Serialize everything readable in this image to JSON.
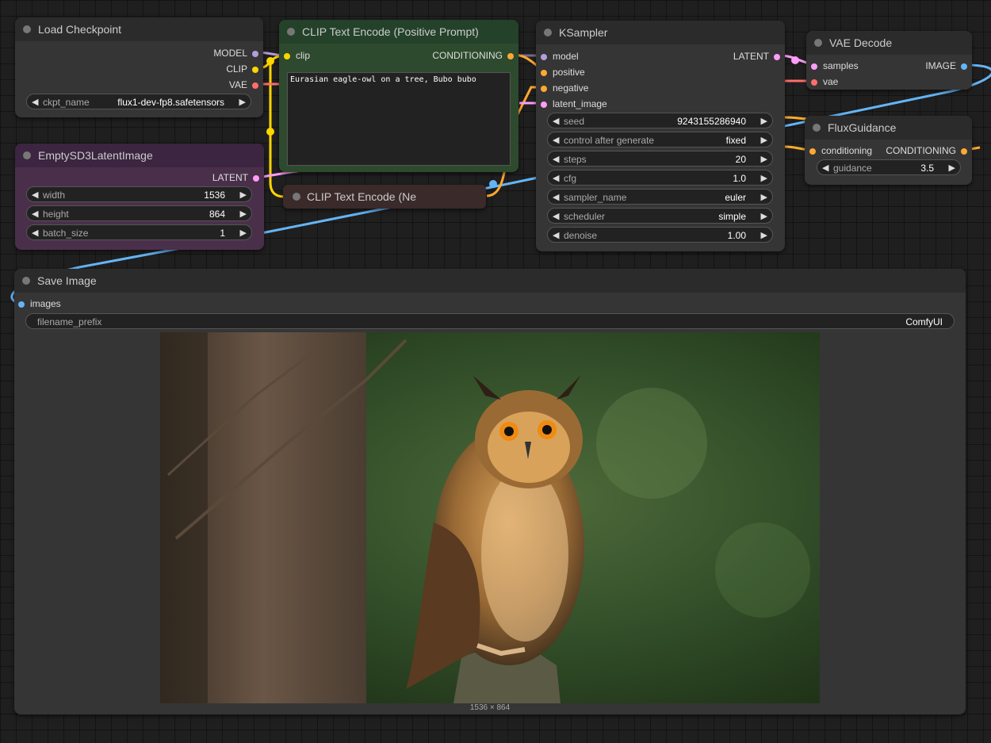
{
  "nodes": {
    "load_checkpoint": {
      "title": "Load Checkpoint",
      "outputs": [
        "MODEL",
        "CLIP",
        "VAE"
      ],
      "ckpt_name": {
        "label": "ckpt_name",
        "value": "flux1-dev-fp8.safetensors"
      }
    },
    "clip_positive": {
      "title": "CLIP Text Encode (Positive Prompt)",
      "input": "clip",
      "output": "CONDITIONING",
      "text": "Eurasian eagle-owl on a tree, Bubo bubo"
    },
    "clip_negative": {
      "title": "CLIP Text Encode (Ne"
    },
    "empty_latent": {
      "title": "EmptySD3LatentImage",
      "output": "LATENT",
      "widgets": [
        {
          "label": "width",
          "value": "1536"
        },
        {
          "label": "height",
          "value": "864"
        },
        {
          "label": "batch_size",
          "value": "1"
        }
      ]
    },
    "ksampler": {
      "title": "KSampler",
      "inputs": [
        "model",
        "positive",
        "negative",
        "latent_image"
      ],
      "output": "LATENT",
      "widgets": [
        {
          "label": "seed",
          "value": "924315528694​0"
        },
        {
          "label": "control after generate",
          "value": "fixed"
        },
        {
          "label": "steps",
          "value": "20"
        },
        {
          "label": "cfg",
          "value": "1.0"
        },
        {
          "label": "sampler_name",
          "value": "euler"
        },
        {
          "label": "scheduler",
          "value": "simple"
        },
        {
          "label": "denoise",
          "value": "1.00"
        }
      ]
    },
    "vae_decode": {
      "title": "VAE Decode",
      "inputs": [
        "samples",
        "vae"
      ],
      "output": "IMAGE"
    },
    "flux_guidance": {
      "title": "FluxGuidance",
      "input": "conditioning",
      "output": "CONDITIONING",
      "guidance": {
        "label": "guidance",
        "value": "3.5"
      }
    },
    "save_image": {
      "title": "Save Image",
      "input": "images",
      "filename_prefix": {
        "label": "filename_prefix",
        "value": "ComfyUI"
      },
      "image_size": "1536 × 864"
    }
  },
  "colors": {
    "model": "#b39ddb",
    "clip": "#ffd500",
    "vae": "#ff6e6e",
    "conditioning": "#ffa931",
    "latent": "#ff9cf9",
    "image": "#64b5f6",
    "positive_node_bg": "#2e4a2e",
    "latent_node_bg": "#4a2f4a",
    "negative_node_bg": "#3b2a2a"
  },
  "icons": {
    "widget_left": "◀",
    "widget_right": "▶",
    "node_status": "node-dot-icon"
  }
}
